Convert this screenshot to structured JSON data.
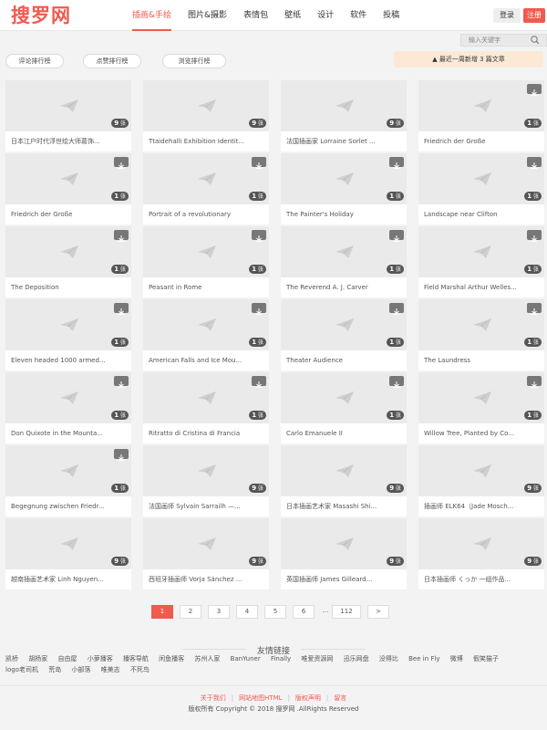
{
  "logo": "搜罗网",
  "nav": [
    "插画&手绘",
    "图片&摄影",
    "表情包",
    "壁纸",
    "设计",
    "软件",
    "投稿"
  ],
  "login": "登录",
  "register": "注册",
  "search_placeholder": "输入关键字",
  "rank_tabs": [
    "评论排行榜",
    "点赞排行榜",
    "浏览排行榜"
  ],
  "recent_label": "最近一周新增 3 篇文章",
  "cards": [
    {
      "caption": "日本江户时代浮世绘大师葛饰...",
      "count": "9",
      "dl": false
    },
    {
      "caption": "Ttaidehalli Exhibition Identit...",
      "count": "9",
      "dl": false
    },
    {
      "caption": "法国插画家 Lorraine Sorlet ...",
      "count": "9",
      "dl": false
    },
    {
      "caption": "Friedrich der Große",
      "count": "1",
      "dl": true
    },
    {
      "caption": "Friedrich der Große",
      "count": "1",
      "dl": true
    },
    {
      "caption": "Portrait of a revolutionary",
      "count": "1",
      "dl": true
    },
    {
      "caption": "The Painter's Holiday",
      "count": "1",
      "dl": true
    },
    {
      "caption": "Landscape near Clifton",
      "count": "1",
      "dl": true
    },
    {
      "caption": "The Deposition",
      "count": "1",
      "dl": true
    },
    {
      "caption": "Peasant in Rome",
      "count": "1",
      "dl": true
    },
    {
      "caption": "The Reverend A. J. Carver",
      "count": "1",
      "dl": true
    },
    {
      "caption": "Field Marshal Arthur Welles...",
      "count": "1",
      "dl": true
    },
    {
      "caption": "Eleven headed 1000 armed...",
      "count": "1",
      "dl": true
    },
    {
      "caption": "American Falls and Ice Mou...",
      "count": "1",
      "dl": true
    },
    {
      "caption": "Theater Audience",
      "count": "1",
      "dl": true
    },
    {
      "caption": "The Laundress",
      "count": "1",
      "dl": true
    },
    {
      "caption": "Don Quixote in the Mounta...",
      "count": "1",
      "dl": true
    },
    {
      "caption": "Ritratto di Cristina di Francia",
      "count": "1",
      "dl": true
    },
    {
      "caption": "Carlo Emanuele II",
      "count": "1",
      "dl": true
    },
    {
      "caption": "Willow Tree, Planted by Co...",
      "count": "1",
      "dl": true
    },
    {
      "caption": "Begegnung zwischen Friedr...",
      "count": "1",
      "dl": true
    },
    {
      "caption": "法国画师 Sylvain Sarrailh —...",
      "count": "9",
      "dl": false
    },
    {
      "caption": "日本插画艺术家 Masashi Shi...",
      "count": "9",
      "dl": false
    },
    {
      "caption": "插画师 ELK64（Jade Mosch...",
      "count": "9",
      "dl": false
    },
    {
      "caption": "越南插画艺术家 Linh Nguyen...",
      "count": "9",
      "dl": false
    },
    {
      "caption": "西班牙插画师 Vorja Sánchez ...",
      "count": "9",
      "dl": false
    },
    {
      "caption": "英国插画师 James Gilleard...",
      "count": "9",
      "dl": false
    },
    {
      "caption": "日本插画师 くっか 一组作品...",
      "count": "9",
      "dl": false
    }
  ],
  "count_unit": "张",
  "pager": [
    "1",
    "2",
    "3",
    "4",
    "5",
    "6",
    "...",
    "112",
    ">"
  ],
  "friends_title": "友情链接",
  "friends": [
    "凯桥",
    "胡杨家",
    "自由屋",
    "小萝播客",
    "播客导航",
    "闲鱼播客",
    "苏州人家",
    "BanYuner",
    "Finally",
    "唯爱资源网",
    "迅乐网盘",
    "没得比",
    "Bee in Fly",
    "微博",
    "假笑猫子",
    "logo老司机",
    "荒岛",
    "小部落",
    "唯美志",
    "不死鸟"
  ],
  "footer_links": [
    "关于我们",
    "网站地图HTML",
    "版权声明",
    "留言"
  ],
  "copyright": "版权所有 Copyright © 2018 搜罗网 .AllRights Reserved"
}
